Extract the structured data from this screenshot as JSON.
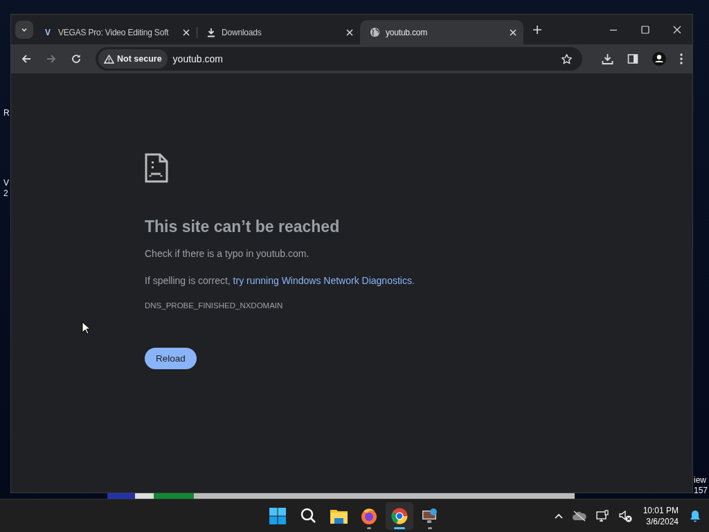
{
  "desktop_left": [
    "R",
    "V\n2"
  ],
  "desktop_right": [
    "iew\n157"
  ],
  "browser": {
    "tabs": [
      {
        "title": "VEGAS Pro: Video Editing Soft",
        "favicon": "V",
        "kind": "letter",
        "selected": false
      },
      {
        "title": "Downloads",
        "kind": "download",
        "selected": false
      },
      {
        "title": "youtub.com",
        "kind": "globe",
        "selected": true
      }
    ],
    "security_chip": "Not secure",
    "url": "youtub.com",
    "error_page": {
      "title": "This site can’t be reached",
      "hint": "Check if there is a typo in youtub.com.",
      "advice": "If spelling is correct, ",
      "advice_link": "try running Windows Network Diagnostics",
      "advice_end": ".",
      "code": "DNS_PROBE_FINISHED_NXDOMAIN",
      "button": "Reload"
    }
  },
  "taskbar": {
    "apps": [
      {
        "kind": "start",
        "running": false,
        "selected": false
      },
      {
        "kind": "search",
        "running": false,
        "selected": false
      },
      {
        "kind": "folder",
        "running": false,
        "selected": false
      },
      {
        "kind": "firefox",
        "running": true,
        "selected": false
      },
      {
        "kind": "chrome",
        "running": true,
        "selected": true
      },
      {
        "kind": "remote",
        "running": true,
        "selected": false
      }
    ],
    "time": "10:01 PM",
    "date": "3/6/2024"
  }
}
